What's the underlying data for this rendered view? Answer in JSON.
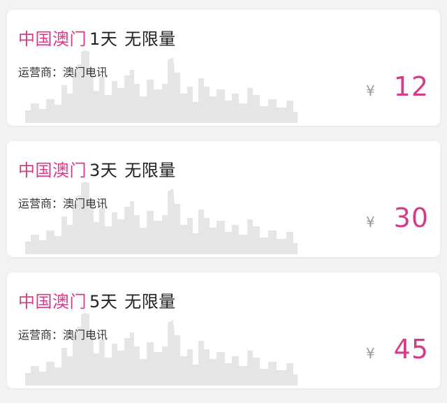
{
  "plans": [
    {
      "region": "中国澳门",
      "days": "1天",
      "data_type": "无限量",
      "operator_label": "运营商：",
      "operator_name": "澳门电讯",
      "currency": "¥",
      "price": "12"
    },
    {
      "region": "中国澳门",
      "days": "3天",
      "data_type": "无限量",
      "operator_label": "运营商：",
      "operator_name": "澳门电讯",
      "currency": "¥",
      "price": "30"
    },
    {
      "region": "中国澳门",
      "days": "5天",
      "data_type": "无限量",
      "operator_label": "运营商：",
      "operator_name": "澳门电讯",
      "currency": "¥",
      "price": "45"
    }
  ],
  "colors": {
    "accent": "#d23c89",
    "skyline": "#e3e5e7",
    "card_bg": "#ffffff",
    "page_bg": "#f2f2f4"
  },
  "icons": {
    "card_background": "macau-skyline-illustration"
  }
}
